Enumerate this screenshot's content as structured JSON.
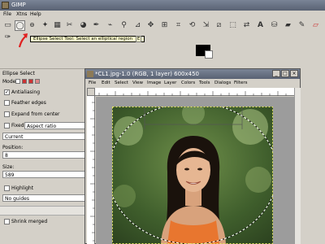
{
  "toolbox": {
    "title": "GIMP",
    "menu": [
      "File",
      "Xtns",
      "Help"
    ]
  },
  "tooltip": {
    "text": "Ellipse Select Tool: Select an elliptical region",
    "shortcut": "E"
  },
  "tool_options": {
    "title": "Ellipse Select",
    "mode_label": "Mode:",
    "antialiasing": {
      "label": "Antialiasing",
      "checked": true
    },
    "feather": {
      "label": "Feather edges",
      "checked": false
    },
    "expand": {
      "label": "Expand from center",
      "checked": false
    },
    "fixed": {
      "label": "Fixed:",
      "checked": false,
      "value": "Aspect ratio"
    },
    "fixed_value": "Current",
    "position_label": "Position:",
    "position_value": "8",
    "size_label": "Size:",
    "size_value": "589",
    "highlight": {
      "label": "Highlight",
      "checked": false
    },
    "guides_value": "No guides",
    "shrink": {
      "label": "Shrink merged",
      "checked": false
    }
  },
  "image_window": {
    "title": "*CL1.jpg-1.0 (RGB, 1 layer) 600x450",
    "menu": [
      "File",
      "Edit",
      "Select",
      "View",
      "Image",
      "Layer",
      "Colors",
      "Tools",
      "Dialogs",
      "Filters"
    ]
  },
  "colors": {
    "titlebar": "#596273",
    "arrow": "#e02020",
    "foreground": "#000000",
    "background": "#ffffff"
  }
}
